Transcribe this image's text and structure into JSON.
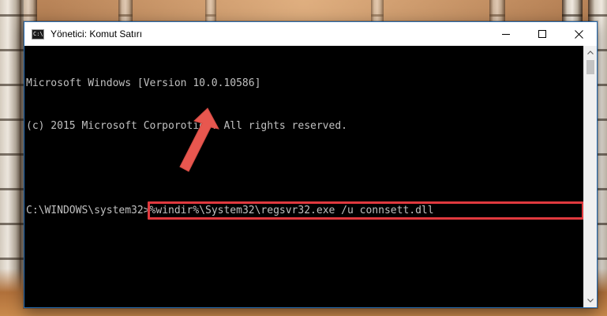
{
  "window": {
    "title": "Yönetici: Komut Satırı",
    "icon_text": "C:\\"
  },
  "console": {
    "lines": [
      "Microsoft Windows [Version 10.0.10586]",
      "(c) 2015 Microsoft Corporotion. All rights reserved."
    ],
    "prompt": "C:\\WINDOWS\\system32>",
    "command": "%windir%\\System32\\regsvr32.exe /u connsett.dll"
  },
  "icons": {
    "minimize": "minimize-icon",
    "maximize": "maximize-icon",
    "close": "close-icon",
    "scroll_up": "chevron-up-icon",
    "scroll_down": "chevron-down-icon",
    "annotation": "arrow-icon"
  },
  "colors": {
    "highlight": "#e0393e",
    "console_bg": "#000000",
    "console_text": "#c0c0c0",
    "arrow": "#e8574f"
  }
}
